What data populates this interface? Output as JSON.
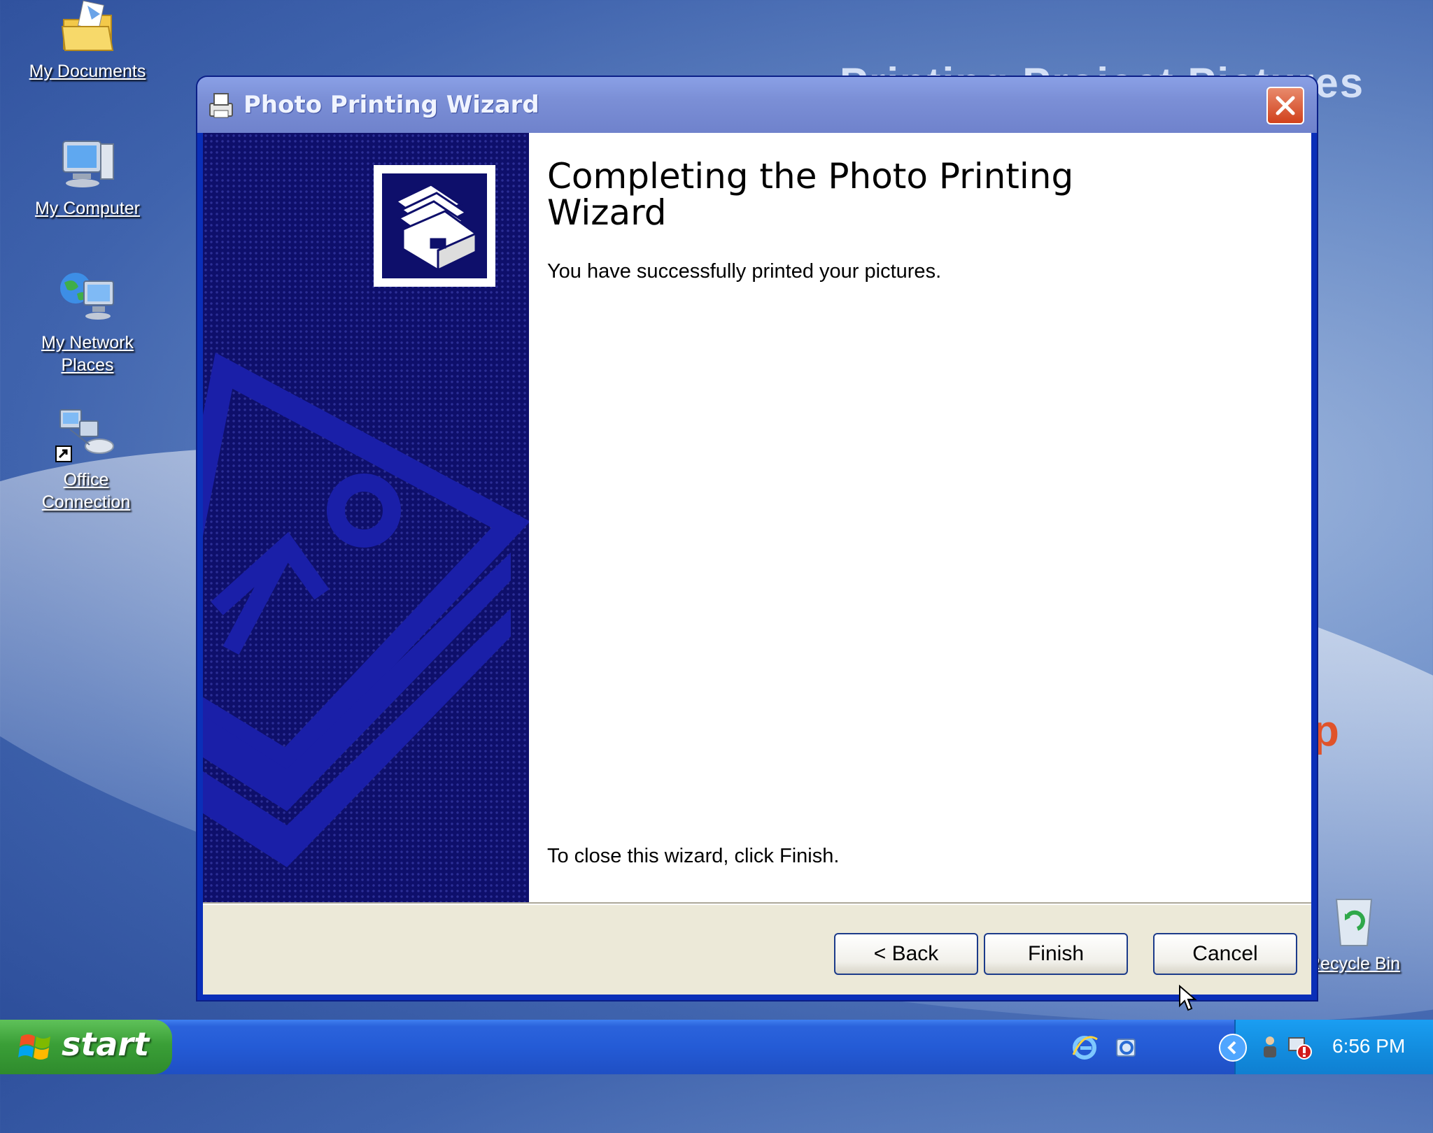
{
  "desktop": {
    "background_text": "Printing Project Pictures",
    "background_red_text": "p",
    "icons": [
      {
        "label": "My Documents",
        "icon": "folder-documents-icon"
      },
      {
        "label": "My Computer",
        "icon": "computer-icon"
      },
      {
        "label": "My Network Places",
        "icon": "network-places-icon"
      },
      {
        "label": "Office Connection",
        "icon": "office-connection-shortcut-icon"
      },
      {
        "label": "Recycle Bin",
        "icon": "recycle-bin-icon"
      }
    ]
  },
  "dialog": {
    "title": "Photo Printing Wizard",
    "heading": "Completing the Photo Printing Wizard",
    "message": "You have successfully printed your pictures.",
    "close_message": "To close this wizard, click Finish.",
    "buttons": {
      "back": "< Back",
      "finish": "Finish",
      "cancel": "Cancel"
    }
  },
  "taskbar": {
    "start_label": "start",
    "clock": "6:56 PM"
  },
  "colors": {
    "titlebar": "#7b8fd6",
    "wizard_side_panel": "#0e0f6b",
    "taskbar": "#245bd6",
    "start_button": "#3a9f37",
    "tray": "#138ee0"
  }
}
